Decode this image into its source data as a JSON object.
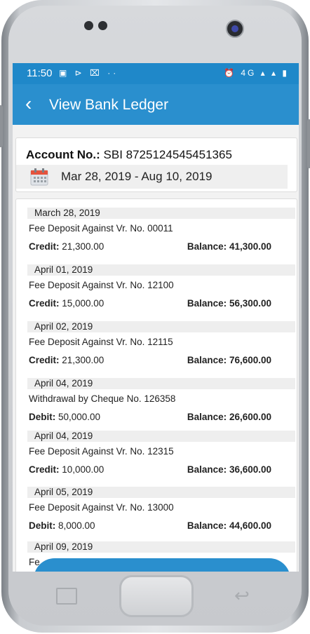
{
  "status_bar": {
    "time": "11:50",
    "left_icons": "▣ ⊳ ⌧  ··",
    "right_icons": "⏰ 4G ▴ ▴ ▮"
  },
  "app_bar": {
    "back_icon": "‹",
    "title": "View Bank Ledger"
  },
  "account": {
    "label": "Account No.:",
    "number": "SBI 8725124545451365",
    "date_range": "Mar 28, 2019 - Aug 10, 2019"
  },
  "entries": [
    {
      "date": "March 28, 2019",
      "desc": "Fee Deposit Against Vr. No. 00011",
      "amt_label": "Credit:",
      "amount": " 21,300.00",
      "bal_label": "Balance:",
      "balance": " 41,300.00"
    },
    {
      "date": "April 01, 2019",
      "desc": "Fee Deposit Against Vr. No. 12100",
      "amt_label": "Credit:",
      "amount": " 15,000.00",
      "bal_label": "Balance:",
      "balance": " 56,300.00"
    },
    {
      "date": "April 02, 2019",
      "desc": "Fee Deposit Against Vr. No. 12115",
      "amt_label": "Credit:",
      "amount": " 21,300.00",
      "bal_label": "Balance:",
      "balance": " 76,600.00"
    },
    {
      "date": "April 04, 2019",
      "desc": "Withdrawal by Cheque No. 126358",
      "amt_label": "Debit:",
      "amount": " 50,000.00",
      "bal_label": "Balance:",
      "balance": " 26,600.00"
    },
    {
      "date": "April 04, 2019",
      "desc": "Fee Deposit Against Vr. No. 12315",
      "amt_label": "Credit:",
      "amount": " 10,000.00",
      "bal_label": "Balance:",
      "balance": " 36,600.00"
    },
    {
      "date": "April 05, 2019",
      "desc": "Fee Deposit Against Vr. No. 13000",
      "amt_label": "Debit:",
      "amount": " 8,000.00",
      "bal_label": "Balance:",
      "balance": " 44,600.00"
    },
    {
      "date": "April 09, 2019",
      "desc": "Fe",
      "amt_label": "",
      "amount": "",
      "bal_label": "",
      "balance": ""
    }
  ],
  "colors": {
    "accent": "#2a8fce",
    "status_bar": "#1f88c9"
  }
}
